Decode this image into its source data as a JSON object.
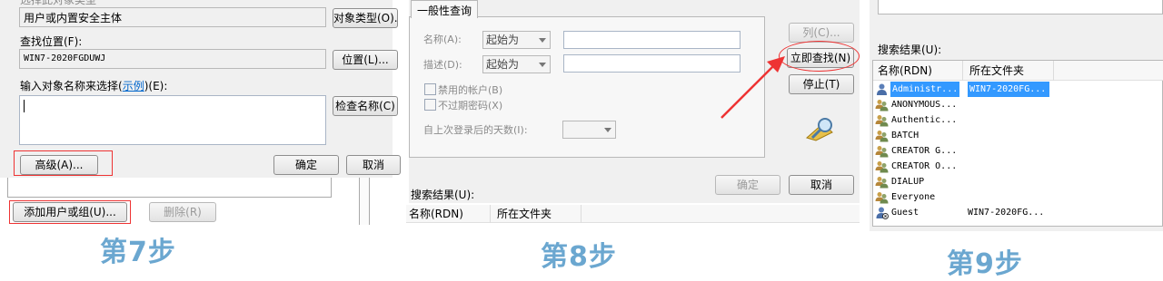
{
  "panel1": {
    "object_type_label_cut": "选择此对象类型",
    "object_type_value": "用户或内置安全主体",
    "object_type_button": "对象类型(O)...",
    "location_label": "查找位置(F):",
    "location_value": "WIN7-2020FGDUWJ",
    "location_button": "位置(L)...",
    "enter_names_prefix": "输入对象名称来选择(",
    "enter_names_link": "示例",
    "enter_names_suffix": ")(E):",
    "check_names_button": "检查名称(C)",
    "advanced_button": "高级(A)...",
    "ok_button": "确定",
    "cancel_button": "取消",
    "add_user_button": "添加用户或组(U)...",
    "remove_button": "删除(R)",
    "step_label": "第7步"
  },
  "panel2": {
    "tab_label": "一般性查询",
    "name_label": "名称(A):",
    "desc_label": "描述(D):",
    "starts_with_1": "起始为",
    "starts_with_2": "起始为",
    "disabled_accounts": "禁用的帐户(B)",
    "non_expiring": "不过期密码(X)",
    "days_since_logon": "自上次登录后的天数(I):",
    "columns_button": "列(C)...",
    "find_now_button": "立即查找(N)",
    "stop_button": "停止(T)",
    "ok_button": "确定",
    "cancel_button": "取消",
    "results_label": "搜索结果(U):",
    "col_name": "名称(RDN)",
    "col_folder": "所在文件夹",
    "step_label": "第8步"
  },
  "panel3": {
    "results_label": "搜索结果(U):",
    "col_name": "名称(RDN)",
    "col_folder": "所在文件夹",
    "rows": [
      {
        "name": "Administr...",
        "folder": "WIN7-2020FG...",
        "icon": "user-icon"
      },
      {
        "name": "ANONYMOUS...",
        "folder": "",
        "icon": "group-icon"
      },
      {
        "name": "Authentic...",
        "folder": "",
        "icon": "group-icon"
      },
      {
        "name": "BATCH",
        "folder": "",
        "icon": "group-icon"
      },
      {
        "name": "CREATOR G...",
        "folder": "",
        "icon": "group-icon"
      },
      {
        "name": "CREATOR O...",
        "folder": "",
        "icon": "group-icon"
      },
      {
        "name": "DIALUP",
        "folder": "",
        "icon": "group-icon"
      },
      {
        "name": "Everyone",
        "folder": "",
        "icon": "group-icon"
      },
      {
        "name": "Guest",
        "folder": "WIN7-2020FG...",
        "icon": "user-disabled-icon"
      }
    ],
    "step_label": "第9步"
  },
  "colors": {
    "accent_red": "#e33333",
    "step_blue": "#6ba7d0",
    "selection_blue": "#3399ff"
  }
}
